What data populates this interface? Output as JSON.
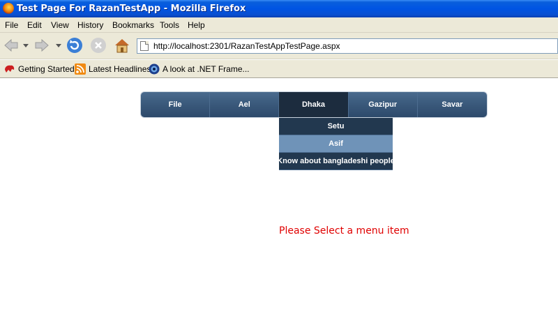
{
  "window": {
    "title": "Test Page For RazanTestApp - Mozilla Firefox"
  },
  "menubar": [
    "File",
    "Edit",
    "View",
    "History",
    "Bookmarks",
    "Tools",
    "Help"
  ],
  "address": {
    "url": "http://localhost:2301/RazanTestAppTestPage.aspx"
  },
  "bookmarks": [
    {
      "label": "Getting Started",
      "icon": "getting-started-icon"
    },
    {
      "label": "Latest Headlines",
      "icon": "rss-icon"
    },
    {
      "label": "A look at .NET Frame...",
      "icon": "net-icon"
    }
  ],
  "site_menu": {
    "items": [
      "File",
      "Ael",
      "Dhaka",
      "Gazipur",
      "Savar"
    ],
    "active": "Dhaka",
    "dropdown": [
      "Setu",
      "Asif",
      "Know about bangladeshi people"
    ],
    "hovered": "Asif"
  },
  "message": "Please Select a menu item",
  "colors": {
    "menu_bg": "#3b5a7c",
    "menu_active": "#1c2c3e",
    "dropdown_hover": "#6f93b8",
    "message": "#e00000"
  }
}
